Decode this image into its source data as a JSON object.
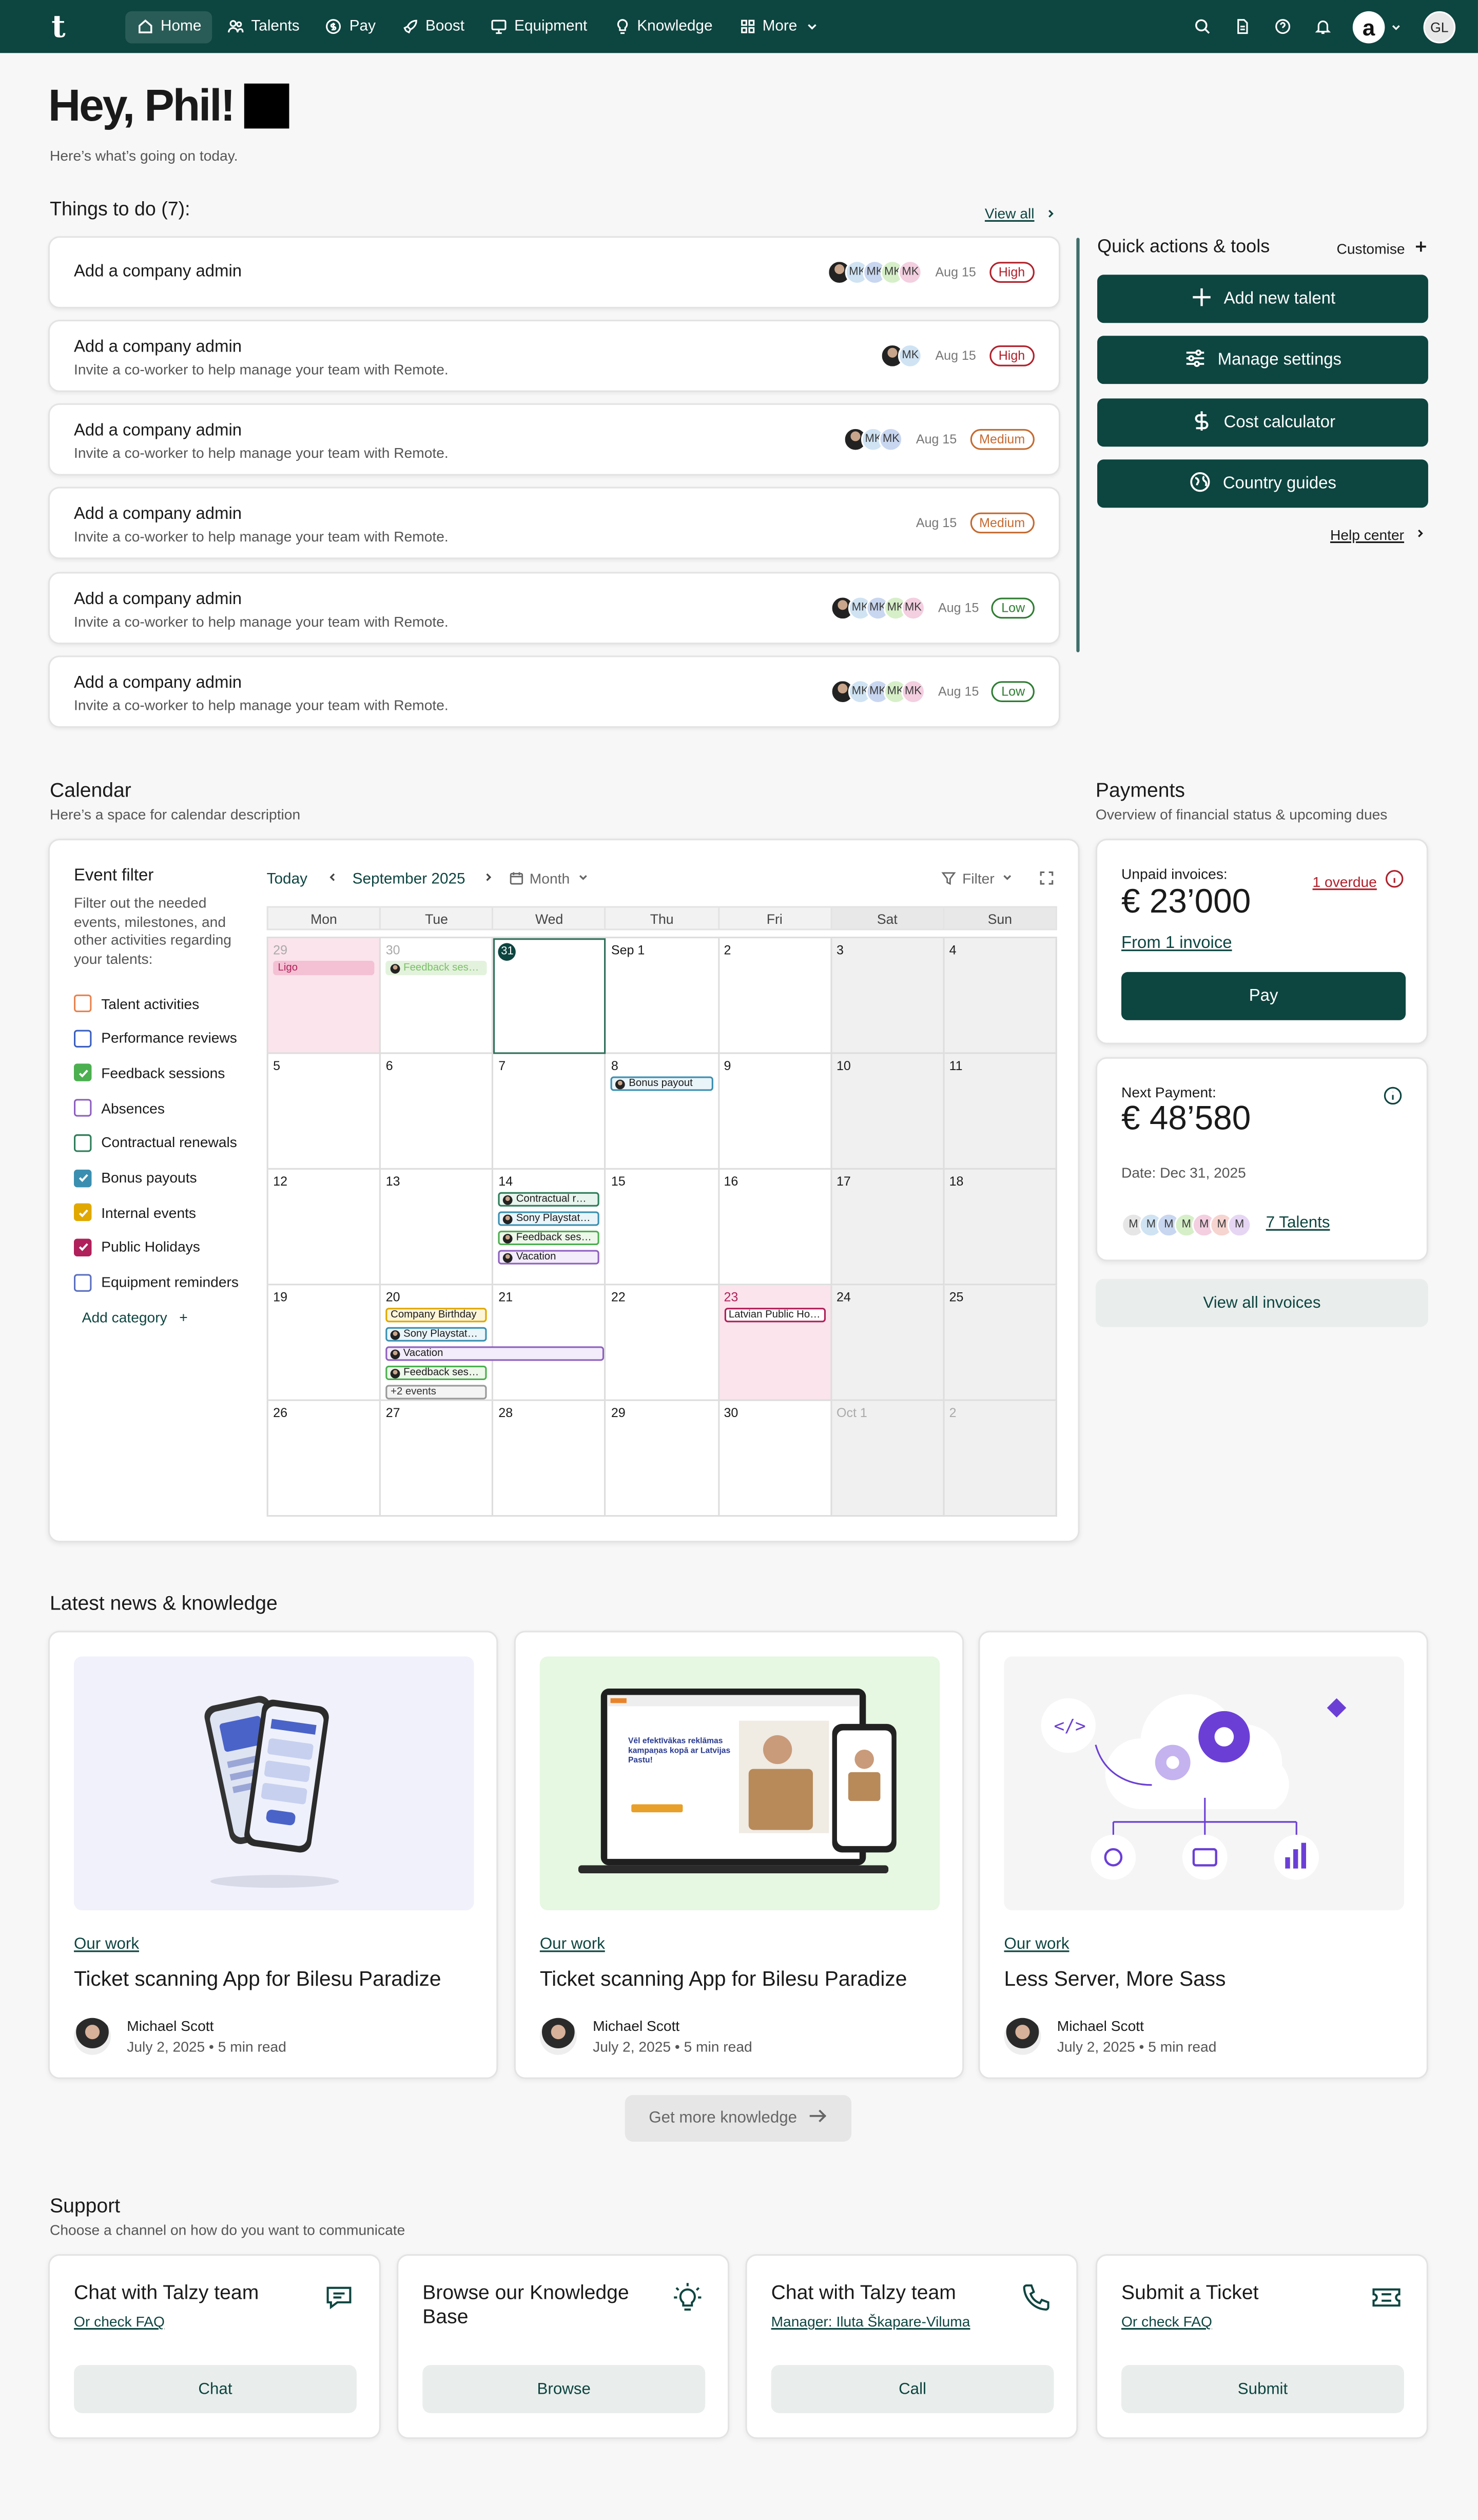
{
  "nav": {
    "logo": "t",
    "items": [
      {
        "label": "Home",
        "icon": "home-icon"
      },
      {
        "label": "Talents",
        "icon": "users-icon"
      },
      {
        "label": "Pay",
        "icon": "coin-icon"
      },
      {
        "label": "Boost",
        "icon": "rocket-icon"
      },
      {
        "label": "Equipment",
        "icon": "monitor-icon"
      },
      {
        "label": "Knowledge",
        "icon": "lightbulb-icon"
      },
      {
        "label": "More",
        "icon": "grid-icon"
      }
    ],
    "brand_badge": "a",
    "user_initials": "GL"
  },
  "greeting": {
    "title": "Hey, Phil!",
    "subtitle": "Here’s what’s going on today."
  },
  "todos": {
    "title": "Things to do (7):",
    "view_all": "View all",
    "items": [
      {
        "title": "Add a company admin",
        "desc": "",
        "date": "Aug 15",
        "priority": "High",
        "avatars": [
          "photo",
          "MK",
          "MK",
          "MK",
          "MK"
        ]
      },
      {
        "title": "Add a company admin",
        "desc": "Invite a co-worker to help manage your team with Remote.",
        "date": "Aug 15",
        "priority": "High",
        "avatars": [
          "photo",
          "MK"
        ]
      },
      {
        "title": "Add a company admin",
        "desc": "Invite a co-worker to help manage your team with Remote.",
        "date": "Aug 15",
        "priority": "Medium",
        "avatars": [
          "photo",
          "MK",
          "MK"
        ]
      },
      {
        "title": "Add a company admin",
        "desc": "Invite a co-worker to help manage your team with Remote.",
        "date": "Aug 15",
        "priority": "Medium",
        "avatars": []
      },
      {
        "title": "Add a company admin",
        "desc": "Invite a co-worker to help manage your team with Remote.",
        "date": "Aug 15",
        "priority": "Low",
        "avatars": [
          "photo",
          "MK",
          "MK",
          "MK",
          "MK"
        ]
      },
      {
        "title": "Add a company admin",
        "desc": "Invite a co-worker to help manage your team with Remote.",
        "date": "Aug 15",
        "priority": "Low",
        "avatars": [
          "photo",
          "MK",
          "MK",
          "MK",
          "MK"
        ]
      }
    ]
  },
  "quick": {
    "title": "Quick actions & tools",
    "customise": "Customise",
    "actions": [
      {
        "label": "Add new talent",
        "icon": "plus-icon"
      },
      {
        "label": "Manage settings",
        "icon": "sliders-icon"
      },
      {
        "label": "Cost calculator",
        "icon": "dollar-icon"
      },
      {
        "label": "Country guides",
        "icon": "globe-icon"
      }
    ],
    "help": "Help center"
  },
  "calendar": {
    "title": "Calendar",
    "subtitle": "Here’s a space for calendar description",
    "filter_title": "Event filter",
    "filter_desc": "Filter out the needed events, milestones, and other activities regarding your talents:",
    "categories": [
      {
        "label": "Talent activities",
        "color": "#e8834f",
        "checked": false
      },
      {
        "label": "Performance reviews",
        "color": "#3a5fbf",
        "checked": false
      },
      {
        "label": "Feedback sessions",
        "color": "#4caf50",
        "checked": true
      },
      {
        "label": "Absences",
        "color": "#8e5fbf",
        "checked": false
      },
      {
        "label": "Contractual renewals",
        "color": "#2e7d5a",
        "checked": false
      },
      {
        "label": "Bonus payouts",
        "color": "#3a8fb0",
        "checked": true
      },
      {
        "label": "Internal events",
        "color": "#e0a800",
        "checked": true
      },
      {
        "label": "Public Holidays",
        "color": "#b0205a",
        "checked": true
      },
      {
        "label": "Equipment reminders",
        "color": "#5a6fbf",
        "checked": false
      }
    ],
    "add_category": "Add category",
    "today": "Today",
    "month_label": "September 2025",
    "view": "Month",
    "filter": "Filter",
    "days": [
      "Mon",
      "Tue",
      "Wed",
      "Thu",
      "Fri",
      "Sat",
      "Sun"
    ],
    "weeks": [
      [
        "29",
        "30",
        "31",
        "Sep 1",
        "2",
        "3",
        "4"
      ],
      [
        "5",
        "6",
        "7",
        "8",
        "9",
        "10",
        "11"
      ],
      [
        "12",
        "13",
        "14",
        "15",
        "16",
        "17",
        "18"
      ],
      [
        "19",
        "20",
        "21",
        "22",
        "23",
        "24",
        "25"
      ],
      [
        "26",
        "27",
        "28",
        "29",
        "30",
        "Oct 1",
        "2"
      ]
    ],
    "events": {
      "ligo": "Ligo",
      "feedback1": "Feedback ses…",
      "bonus": "Bonus payout",
      "contract": "Contractual r…",
      "sony": "Sony Playstat…",
      "feedback2": "Feedback ses…",
      "vacation": "Vacation",
      "birthday": "Company Birthday",
      "sony2": "Sony Playstat…",
      "vacation2": "Vacation",
      "feedback3": "Feedback ses…",
      "more": "+2 events",
      "latvia": "Latvian Public Ho…"
    }
  },
  "payments": {
    "title": "Payments",
    "subtitle": "Overview of financial status & upcoming dues",
    "unpaid_label": "Unpaid invoices:",
    "overdue": "1 overdue",
    "unpaid_amount": "€ 23’000",
    "from_invoice": "From 1 invoice",
    "pay_button": "Pay",
    "next_label": "Next Payment:",
    "next_amount": "€ 48’580",
    "next_date": "Date: Dec 31, 2025",
    "talent_avatars": [
      "M",
      "M",
      "M",
      "M",
      "M",
      "M",
      "M"
    ],
    "talents_link": "7 Talents",
    "view_all": "View all invoices"
  },
  "news": {
    "title": "Latest news & knowledge",
    "items": [
      {
        "tag": "Our work",
        "title": "Ticket scanning App for Bilesu Paradize",
        "author": "Michael Scott",
        "meta": "July 2, 2025 • 5 min read"
      },
      {
        "tag": "Our work",
        "title": "Ticket scanning App for Bilesu Paradize",
        "author": "Michael Scott",
        "meta": "July 2, 2025 • 5 min read",
        "promo": "Vēl efektīvākas reklāmas kampaņas kopā ar Latvijas Pastu!"
      },
      {
        "tag": "Our work",
        "title": "Less Server, More Sass",
        "author": "Michael Scott",
        "meta": "July 2, 2025 • 5 min read"
      }
    ],
    "get_more": "Get more knowledge"
  },
  "support": {
    "title": "Support",
    "subtitle": "Choose a channel on how do you want to communicate",
    "items": [
      {
        "title": "Chat with Talzy team",
        "link": "Or check FAQ",
        "button": "Chat",
        "icon": "chat-icon"
      },
      {
        "title": "Browse our Knowledge Base",
        "link": "",
        "button": "Browse",
        "icon": "lightbulb-icon"
      },
      {
        "title": "Chat with Talzy team",
        "link": "Manager: Iluta Škapare-Viluma",
        "button": "Call",
        "icon": "phone-icon"
      },
      {
        "title": "Submit a Ticket",
        "link": "Or check FAQ",
        "button": "Submit",
        "icon": "ticket-icon"
      }
    ]
  }
}
